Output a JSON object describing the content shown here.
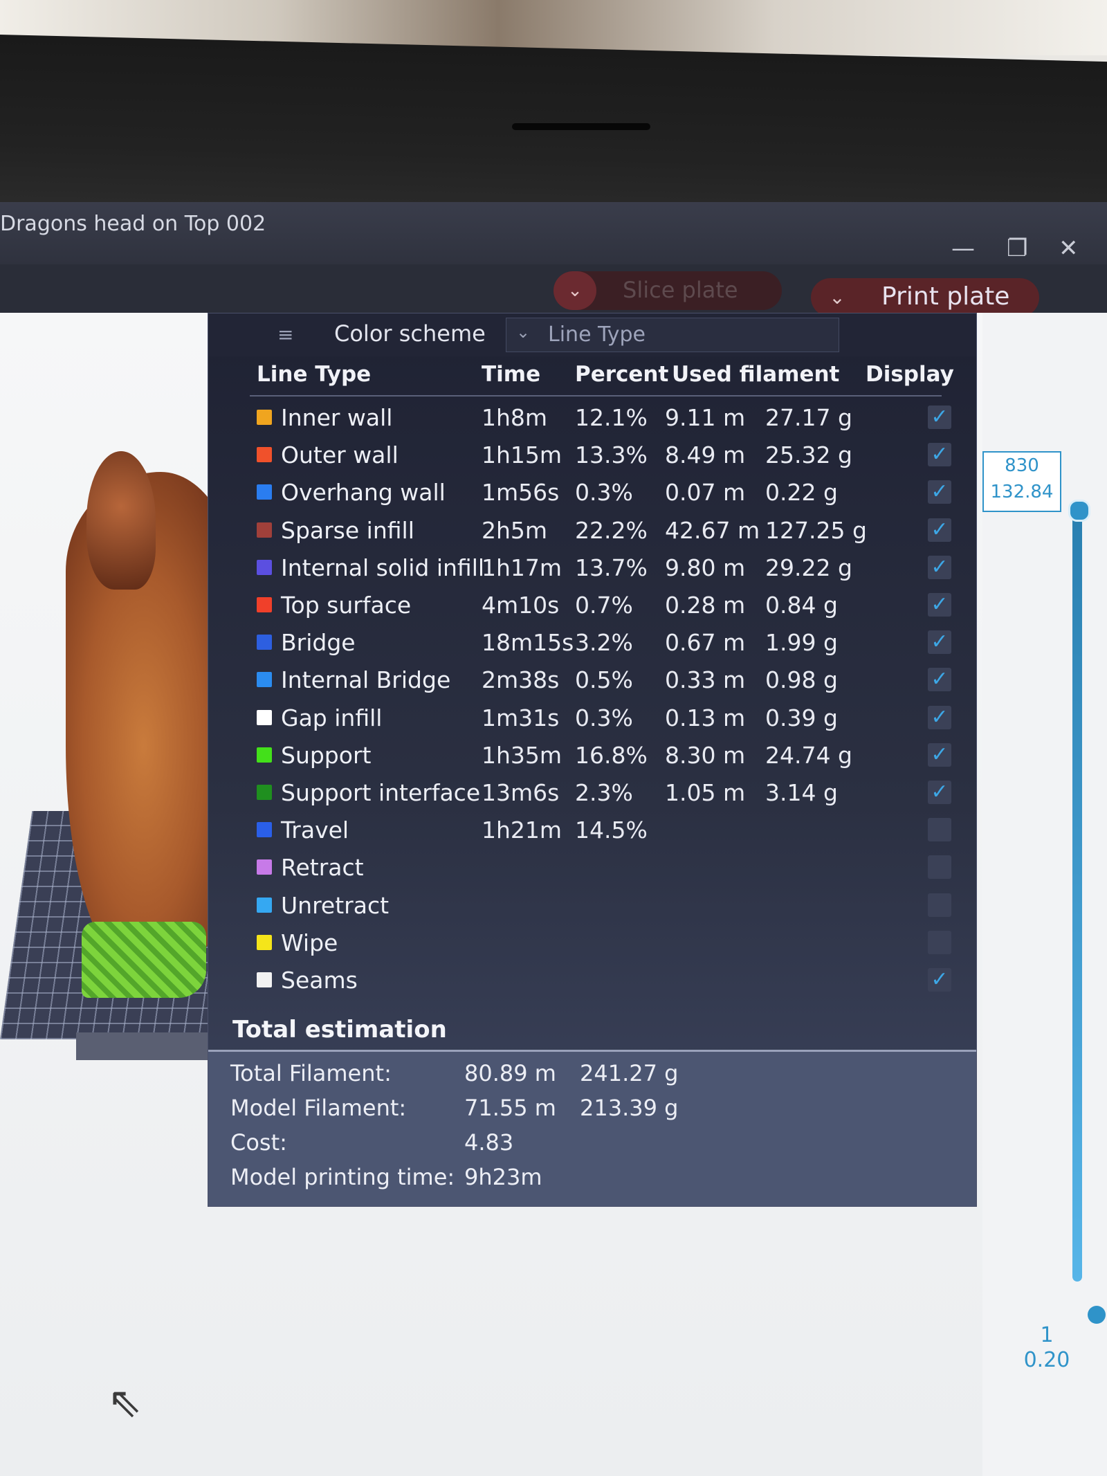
{
  "window": {
    "title": "Dragons head on Top 002",
    "controls": {
      "minimize": "—",
      "restore": "❐",
      "close": "✕"
    }
  },
  "toolbar": {
    "slice_plate": "Slice plate",
    "print_plate": "Print plate"
  },
  "legend": {
    "color_scheme_label": "Color scheme",
    "color_scheme_value": "Line Type",
    "headers": {
      "line_type": "Line Type",
      "time": "Time",
      "percent": "Percent",
      "used_filament": "Used filament",
      "display": "Display"
    },
    "rows": [
      {
        "name": "Inner wall",
        "color": "#f0a51f",
        "time": "1h8m",
        "percent": "12.1%",
        "length": "9.11 m",
        "weight": "27.17 g",
        "display": true
      },
      {
        "name": "Outer wall",
        "color": "#f0512b",
        "time": "1h15m",
        "percent": "13.3%",
        "length": "8.49 m",
        "weight": "25.32 g",
        "display": true
      },
      {
        "name": "Overhang wall",
        "color": "#2a7df0",
        "time": "1m56s",
        "percent": "0.3%",
        "length": "0.07 m",
        "weight": "0.22 g",
        "display": true
      },
      {
        "name": "Sparse infill",
        "color": "#a0403a",
        "time": "2h5m",
        "percent": "22.2%",
        "length": "42.67 m",
        "weight": "127.25 g",
        "display": true
      },
      {
        "name": "Internal solid infill",
        "color": "#5b4fe0",
        "time": "1h17m",
        "percent": "13.7%",
        "length": "9.80 m",
        "weight": "29.22 g",
        "display": true
      },
      {
        "name": "Top surface",
        "color": "#f0402a",
        "time": "4m10s",
        "percent": "0.7%",
        "length": "0.28 m",
        "weight": "0.84 g",
        "display": true
      },
      {
        "name": "Bridge",
        "color": "#2d5fe0",
        "time": "18m15s",
        "percent": "3.2%",
        "length": "0.67 m",
        "weight": "1.99 g",
        "display": true
      },
      {
        "name": "Internal Bridge",
        "color": "#2b8cf0",
        "time": "2m38s",
        "percent": "0.5%",
        "length": "0.33 m",
        "weight": "0.98 g",
        "display": true
      },
      {
        "name": "Gap infill",
        "color": "#ffffff",
        "time": "1m31s",
        "percent": "0.3%",
        "length": "0.13 m",
        "weight": "0.39 g",
        "display": true
      },
      {
        "name": "Support",
        "color": "#43e01a",
        "time": "1h35m",
        "percent": "16.8%",
        "length": "8.30 m",
        "weight": "24.74 g",
        "display": true
      },
      {
        "name": "Support interface",
        "color": "#1f8f1f",
        "time": "13m6s",
        "percent": "2.3%",
        "length": "1.05 m",
        "weight": "3.14 g",
        "display": true
      },
      {
        "name": "Travel",
        "color": "#2a5fe8",
        "time": "1h21m",
        "percent": "14.5%",
        "length": "",
        "weight": "",
        "display": false
      },
      {
        "name": "Retract",
        "color": "#c77ae8",
        "time": "",
        "percent": "",
        "length": "",
        "weight": "",
        "display": false
      },
      {
        "name": "Unretract",
        "color": "#35a8f2",
        "time": "",
        "percent": "",
        "length": "",
        "weight": "",
        "display": false
      },
      {
        "name": "Wipe",
        "color": "#f5e51a",
        "time": "",
        "percent": "",
        "length": "",
        "weight": "",
        "display": false
      },
      {
        "name": "Seams",
        "color": "#f2f2f2",
        "time": "",
        "percent": "",
        "length": "",
        "weight": "",
        "display": true
      }
    ],
    "check_mark": "✓"
  },
  "totals": {
    "title": "Total estimation",
    "total_filament_label": "Total Filament:",
    "total_filament_length": "80.89 m",
    "total_filament_weight": "241.27 g",
    "model_filament_label": "Model Filament:",
    "model_filament_length": "71.55 m",
    "model_filament_weight": "213.39 g",
    "cost_label": "Cost:",
    "cost_value": "4.83",
    "model_time_label": "Model printing time:",
    "model_time_value": "9h23m"
  },
  "layer_slider": {
    "top_layer": "830",
    "top_height": "132.84",
    "bottom_layer": "1",
    "bottom_height": "0.20"
  },
  "icons": {
    "menu": "≡",
    "dropdown": "⌄",
    "cursor": "⇖"
  }
}
